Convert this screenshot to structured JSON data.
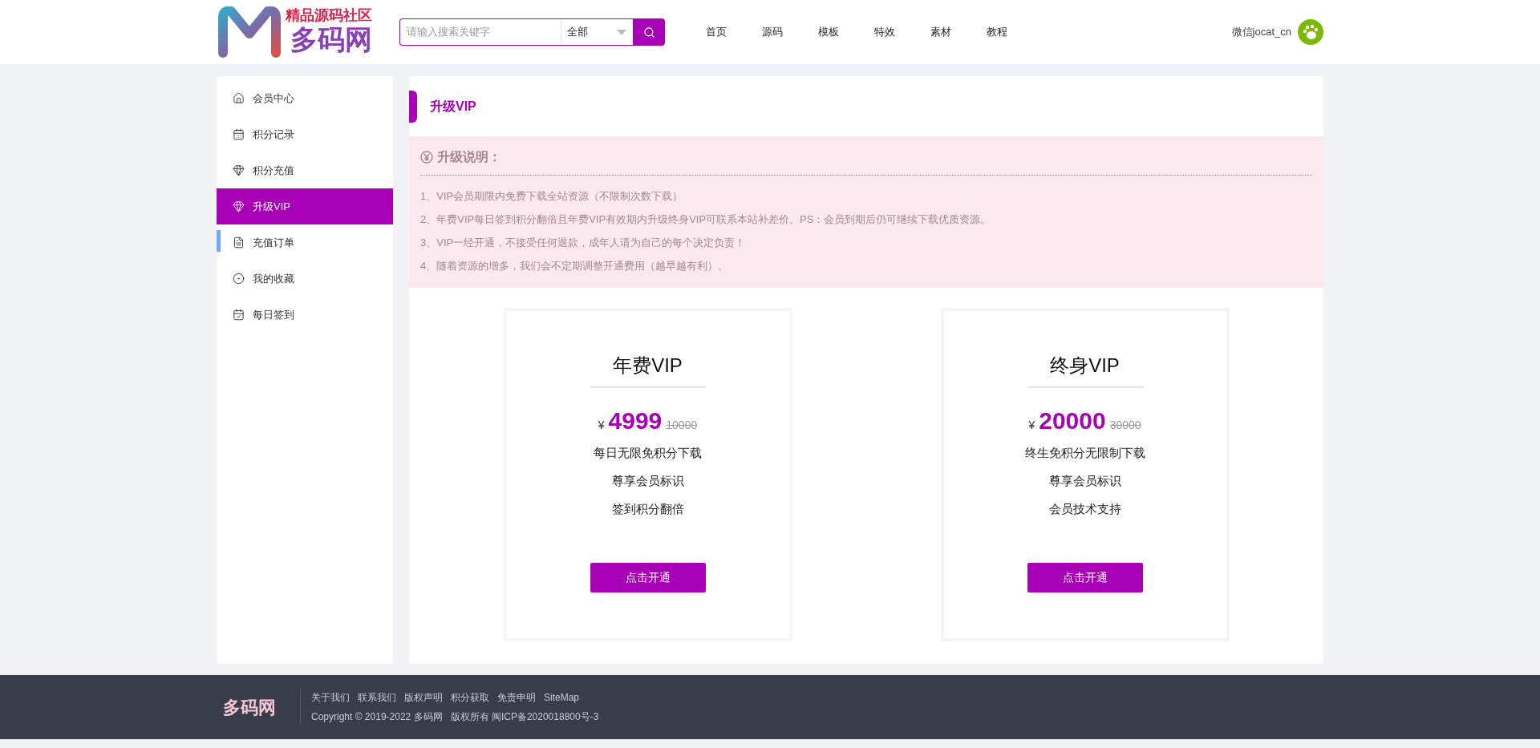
{
  "header": {
    "logo": {
      "tagline": "精品源码社区",
      "name": "多码网"
    },
    "search": {
      "placeholder": "请输入搜索关键字",
      "category": "全部"
    },
    "nav": [
      {
        "label": "首页"
      },
      {
        "label": "源码"
      },
      {
        "label": "模板"
      },
      {
        "label": "特效"
      },
      {
        "label": "素材"
      },
      {
        "label": "教程"
      }
    ],
    "user": {
      "name": "微信jocat_cn"
    }
  },
  "sidebar": {
    "items": [
      {
        "label": "会员中心",
        "selected": false,
        "highlighted": false
      },
      {
        "label": "积分记录",
        "selected": false,
        "highlighted": false
      },
      {
        "label": "积分充值",
        "selected": false,
        "highlighted": false
      },
      {
        "label": "升级VIP",
        "selected": true,
        "highlighted": false
      },
      {
        "label": "充值订单",
        "selected": false,
        "highlighted": true
      },
      {
        "label": "我的收藏",
        "selected": false,
        "highlighted": false
      },
      {
        "label": "每日签到",
        "selected": false,
        "highlighted": false
      }
    ]
  },
  "main": {
    "title": "升级VIP",
    "notice": {
      "heading": "升级说明：",
      "items": [
        "1、VIP会员期限内免费下载全站资源（不限制次数下载）",
        "2、年费VIP每日签到积分翻倍且年费VIP有效期内升级终身VIP可联系本站补差价。PS：会员到期后仍可继续下载优质资源。",
        "3、VIP一经开通，不接受任何退款，成年人请为自己的每个决定负责！",
        "4、随着资源的增多，我们会不定期调整开通费用（越早越有利）。"
      ]
    },
    "plans": [
      {
        "name": "年费VIP",
        "currency": "¥",
        "price": "4999",
        "original_price": "10000",
        "features": [
          "每日无限免积分下载",
          "尊享会员标识",
          "签到积分翻倍"
        ],
        "button": "点击开通"
      },
      {
        "name": "终身VIP",
        "currency": "¥",
        "price": "20000",
        "original_price": "30000",
        "features": [
          "终生免积分无限制下载",
          "尊享会员标识",
          "会员技术支持"
        ],
        "button": "点击开通"
      }
    ]
  },
  "footer": {
    "logo": "多码网",
    "links": [
      "关于我们",
      "联系我们",
      "版权声明",
      "积分获取",
      "免责申明",
      "SiteMap"
    ],
    "copyright": "Copyright © 2019-2022 多码网   版权所有 闽ICP备2020018800号-3"
  }
}
